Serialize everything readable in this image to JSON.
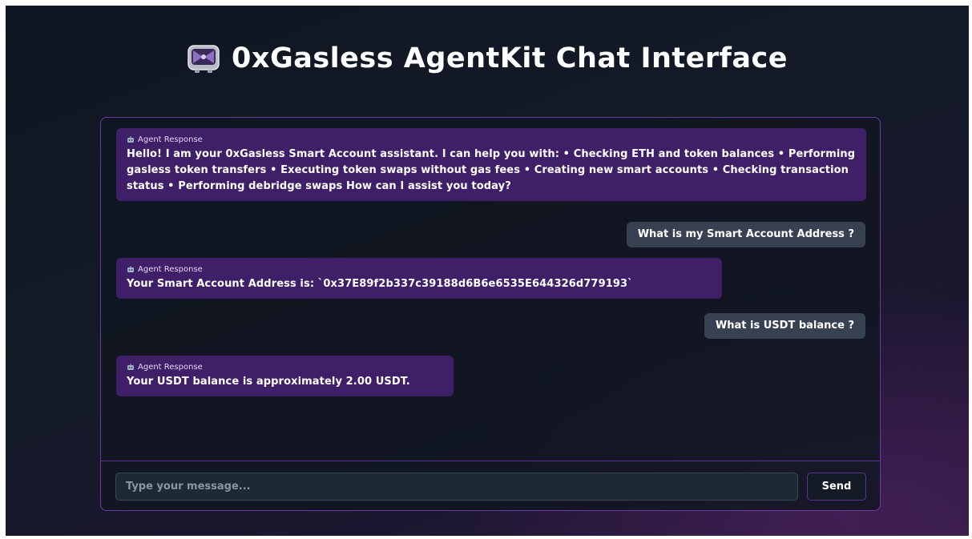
{
  "header": {
    "title": "0xGasless AgentKit Chat Interface",
    "icon": "robot-icon"
  },
  "messages": [
    {
      "role": "agent",
      "label": "Agent Response",
      "text": "Hello! I am your 0xGasless Smart Account assistant. I can help you with: • Checking ETH and token balances • Performing gasless token transfers • Executing token swaps without gas fees • Creating new smart accounts • Checking transaction status • Performing debridge swaps How can I assist you today?"
    },
    {
      "role": "user",
      "text": "What is my Smart Account Address ?"
    },
    {
      "role": "agent",
      "label": "Agent Response",
      "text": "Your Smart Account Address is: `0x37E89f2b337c39188d6B6e6535E644326d779193`"
    },
    {
      "role": "user",
      "text": "What is USDT balance ?"
    },
    {
      "role": "agent",
      "label": "Agent Response",
      "text": "Your USDT balance is approximately 2.00 USDT."
    }
  ],
  "input": {
    "placeholder": "Type your message...",
    "value": ""
  },
  "send": {
    "label": "Send"
  },
  "colors": {
    "accent": "#6b3aa0",
    "agent_bubble": "#3f1f68",
    "user_bubble": "#374151",
    "background": "#141a27"
  }
}
